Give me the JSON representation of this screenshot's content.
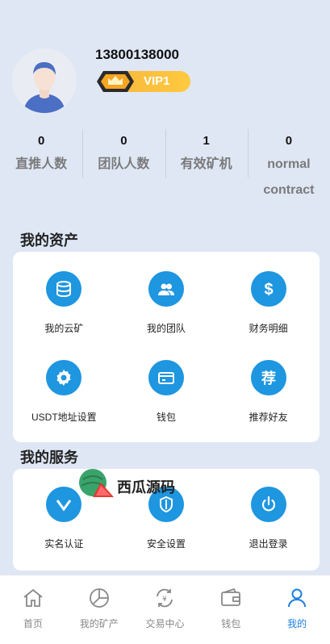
{
  "user": {
    "phone": "13800138000",
    "vip_label": "VIP1"
  },
  "stats": [
    {
      "value": "0",
      "label": "直推人数"
    },
    {
      "value": "0",
      "label": "团队人数"
    },
    {
      "value": "1",
      "label": "有效矿机"
    },
    {
      "value": "0",
      "label": "normal contract"
    }
  ],
  "assets": {
    "title": "我的资产",
    "items": [
      {
        "label": "我的云矿",
        "icon": "database-icon"
      },
      {
        "label": "我的团队",
        "icon": "team-icon"
      },
      {
        "label": "财务明细",
        "icon": "dollar-icon"
      },
      {
        "label": "USDT地址设置",
        "icon": "gear-icon"
      },
      {
        "label": "钱包",
        "icon": "card-icon"
      },
      {
        "label": "推荐好友",
        "icon": "recommend-icon"
      }
    ]
  },
  "services": {
    "title": "我的服务",
    "items": [
      {
        "label": "实名认证",
        "icon": "verify-icon"
      },
      {
        "label": "安全设置",
        "icon": "shield-icon"
      },
      {
        "label": "退出登录",
        "icon": "power-icon"
      }
    ]
  },
  "watermark": {
    "text": "西瓜源码"
  },
  "tabbar": [
    {
      "label": "首页",
      "icon": "home-icon"
    },
    {
      "label": "我的矿产",
      "icon": "pie-icon"
    },
    {
      "label": "交易中心",
      "icon": "exchange-icon"
    },
    {
      "label": "钱包",
      "icon": "wallet-icon"
    },
    {
      "label": "我的",
      "icon": "user-icon"
    }
  ],
  "colors": {
    "accent": "#1e96e0",
    "active_tab": "#1e7fe0",
    "vip": "#ffc93f",
    "background": "#dfe7f5"
  }
}
